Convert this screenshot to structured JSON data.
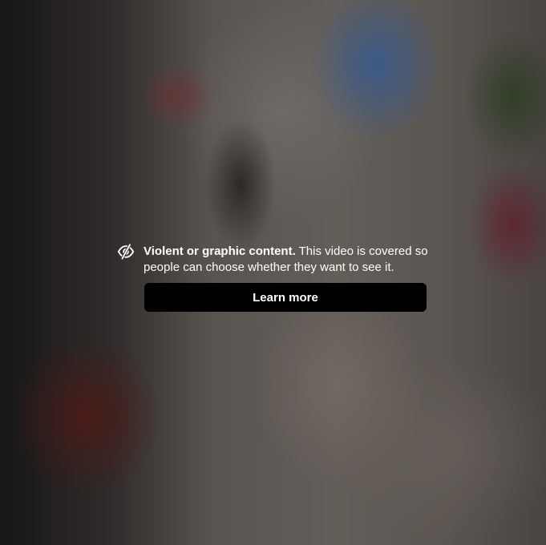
{
  "warning": {
    "icon": "eye-slash-icon",
    "title": "Violent or graphic content.",
    "message": " This video is covered so people can choose whether they want to see it."
  },
  "actions": {
    "learn_more_label": "Learn more"
  },
  "colors": {
    "button_bg": "#000000",
    "text": "#ffffff"
  }
}
